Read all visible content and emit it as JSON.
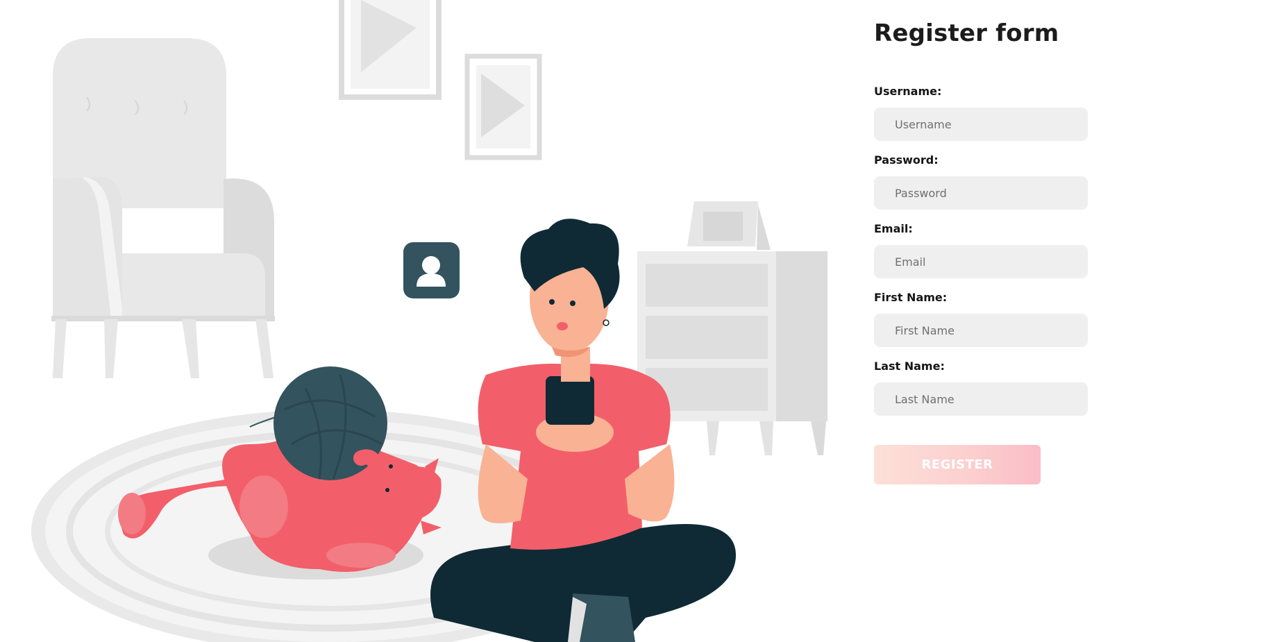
{
  "form": {
    "title": "Register form",
    "fields": [
      {
        "label": "Username:",
        "placeholder": "Username",
        "value": ""
      },
      {
        "label": "Password:",
        "placeholder": "Password",
        "value": ""
      },
      {
        "label": "Email:",
        "placeholder": "Email",
        "value": ""
      },
      {
        "label": "First Name:",
        "placeholder": "First Name",
        "value": ""
      },
      {
        "label": "Last Name:",
        "placeholder": "Last Name",
        "value": ""
      }
    ],
    "submit_label": "REGISTER"
  },
  "illustration": {
    "icons": [
      "armchair-icon",
      "picture-frame-icon",
      "cabinet-icon",
      "user-profile-icon",
      "person-with-phone-icon",
      "cat-with-yarn-icon",
      "rug-icon"
    ],
    "colors": {
      "accent": "#f25f6a",
      "dark": "#0f2a35",
      "slate": "#33535e",
      "skin": "#f9b294",
      "furniture": "#e4e4e4"
    }
  }
}
